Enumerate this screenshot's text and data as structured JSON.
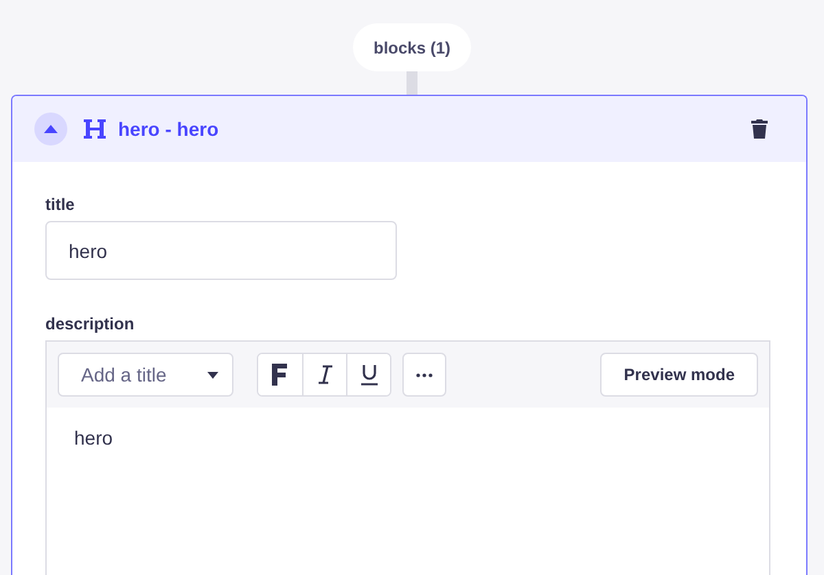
{
  "component_label": "blocks (1)",
  "block": {
    "title": "hero - hero",
    "expanded": true,
    "fields": [
      {
        "kind": "text",
        "label": "title",
        "value": "hero"
      },
      {
        "kind": "richtext",
        "label": "description",
        "heading_select": {
          "placeholder": "Add a title"
        },
        "preview_button": "Preview mode",
        "content": "hero"
      }
    ]
  }
}
